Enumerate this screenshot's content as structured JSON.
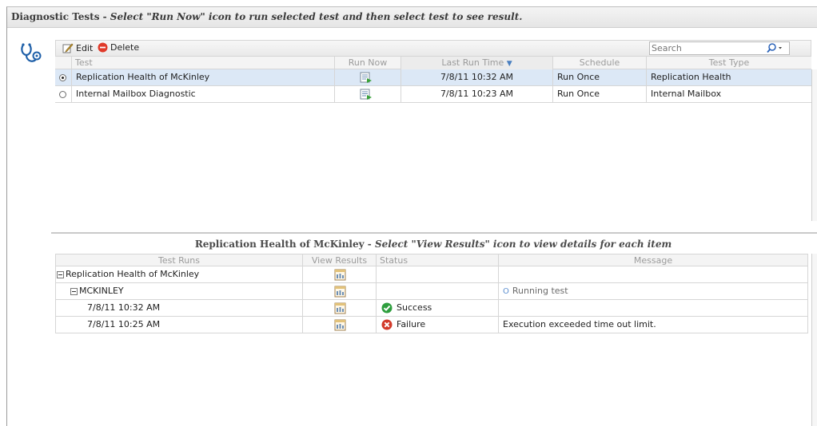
{
  "header": {
    "title": "Diagnostic Tests",
    "instruction": "Select \"Run Now\" icon to run selected test and then select test to see result."
  },
  "toolbar": {
    "edit_label": "Edit",
    "delete_label": "Delete",
    "search_placeholder": "Search"
  },
  "tests_table": {
    "columns": [
      "Test",
      "Run Now",
      "Last Run Time",
      "Schedule",
      "Test Type"
    ],
    "sort_indicator": "▼",
    "rows": [
      {
        "test": "Replication Health of McKinley",
        "last_run": "7/8/11 10:32 AM",
        "schedule": "Run Once",
        "type": "Replication Health",
        "selected": true
      },
      {
        "test": "Internal Mailbox Diagnostic",
        "last_run": "7/8/11 10:23 AM",
        "schedule": "Run Once",
        "type": "Internal Mailbox",
        "selected": false
      }
    ]
  },
  "results_panel": {
    "title": "Replication Health of McKinley",
    "instruction": "Select \"View Results\" icon to view details for each item",
    "columns": [
      "Test Runs",
      "View Results",
      "Status",
      "Message"
    ],
    "rows": [
      {
        "run": "Replication Health of McKinley",
        "status": "",
        "message": ""
      },
      {
        "run": "MCKINLEY",
        "status": "",
        "message": "Running test"
      },
      {
        "run": "7/8/11 10:32 AM",
        "status": "Success",
        "message": ""
      },
      {
        "run": "7/8/11 10:25 AM",
        "status": "Failure",
        "message": "Execution exceeded time out limit."
      }
    ]
  },
  "colors": {
    "selection": "#dce8f6",
    "success": "#2e9e3e",
    "failure": "#d23a2a",
    "delete": "#e03a2a"
  },
  "icons": {
    "header": "stethoscope-icon",
    "edit": "pencil-icon",
    "delete": "minus-circle-icon",
    "search": "magnifier-icon",
    "run": "run-now-icon",
    "view": "view-results-icon"
  }
}
